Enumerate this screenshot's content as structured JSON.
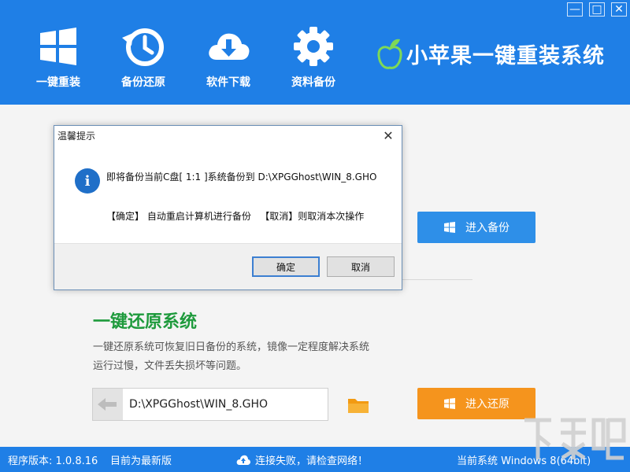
{
  "window": {
    "min_icon": "minimize-icon",
    "max_icon": "maximize-icon",
    "close_icon": "close-icon"
  },
  "nav": [
    {
      "label": "一键重装",
      "icon": "windows-icon"
    },
    {
      "label": "备份还原",
      "icon": "clock-restore-icon"
    },
    {
      "label": "软件下载",
      "icon": "cloud-download-icon"
    },
    {
      "label": "资料备份",
      "icon": "gear-icon"
    }
  ],
  "brand": {
    "name": "小苹果一键重装系统",
    "icon": "apple-logo-icon"
  },
  "main": {
    "backup_button": "进入备份",
    "section_title": "一键还原系统",
    "section_desc": "一键还原系统可恢复旧日备份的系统，镜像一定程度解决系统运行过慢，文件丢失损坏等问题。",
    "path_value": "D:\\XPGGhost\\WIN_8.GHO",
    "restore_button": "进入还原"
  },
  "dialog": {
    "title": "温馨提示",
    "message1": "即将备份当前C盘[ 1:1 ]系统备份到 D:\\XPGGhost\\WIN_8.GHO",
    "message2": "【确定】 自动重启计算机进行备份   【取消】则取消本次操作",
    "ok": "确定",
    "cancel": "取消"
  },
  "status": {
    "version": "程序版本: 1.0.8.16",
    "latest": "目前为最新版",
    "network": "连接失败，请检查网络！",
    "system": "当前系统 Windows 8(64bit)"
  },
  "colors": {
    "header": "#1f7fe6",
    "backup_btn": "#2e8fe8",
    "restore_btn": "#f5941d",
    "title_green": "#1e9a3c"
  }
}
